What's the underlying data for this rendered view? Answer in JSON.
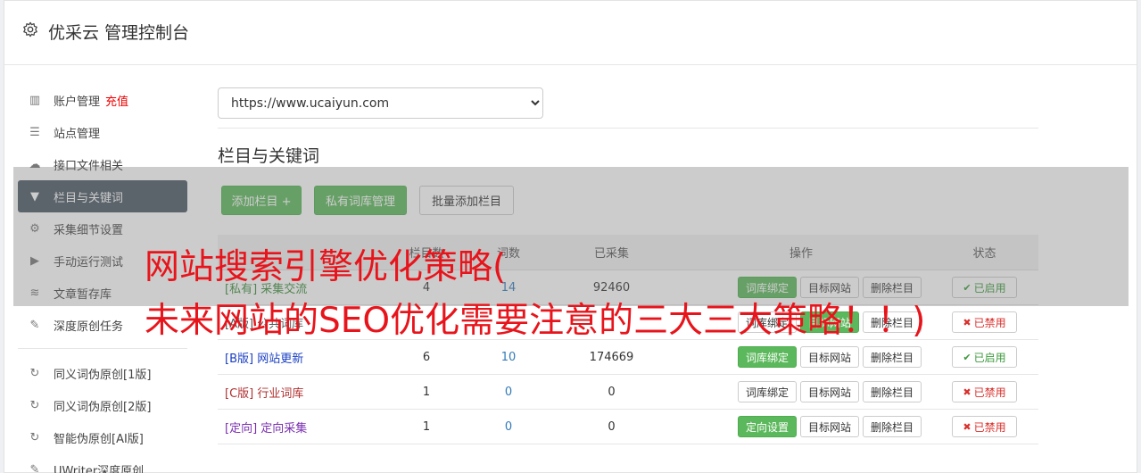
{
  "header": {
    "title": "优采云 管理控制台"
  },
  "sidebar": {
    "items": [
      {
        "label": "账户管理",
        "badge": "充值",
        "icon": "bar-chart-icon",
        "glyph": "▥"
      },
      {
        "label": "站点管理",
        "icon": "server-icon",
        "glyph": "☰"
      },
      {
        "label": "接口文件相关",
        "icon": "cloud-upload-icon",
        "glyph": "☁"
      },
      {
        "label": "栏目与关键词",
        "icon": "filter-icon",
        "glyph": "▼",
        "active": true
      },
      {
        "label": "采集细节设置",
        "icon": "gears-icon",
        "glyph": "⚙"
      },
      {
        "label": "手动运行测试",
        "icon": "play-icon",
        "glyph": "▶"
      },
      {
        "label": "文章暂存库",
        "icon": "database-icon",
        "glyph": "≋"
      },
      {
        "label": "深度原创任务",
        "icon": "edit-icon",
        "glyph": "✎"
      }
    ],
    "items2": [
      {
        "label": "同义词伪原创[1版]",
        "icon": "refresh-icon",
        "glyph": "↻"
      },
      {
        "label": "同义词伪原创[2版]",
        "icon": "refresh-icon",
        "glyph": "↻"
      },
      {
        "label": "智能伪原创[AI版]",
        "icon": "refresh-icon",
        "glyph": "↻"
      },
      {
        "label": "UWriter深度原创",
        "icon": "edit-icon",
        "glyph": "✎"
      }
    ]
  },
  "main": {
    "site_select": "https://www.ucaiyun.com",
    "section_title": "栏目与关键词",
    "buttons": {
      "add": "添加栏目 +",
      "private": "私有词库管理",
      "batch": "批量添加栏目"
    }
  },
  "table": {
    "headers": [
      "",
      "栏目数",
      "词数",
      "已采集",
      "操作",
      "状态"
    ],
    "rows": [
      {
        "name": "[私有] 采集交流",
        "n1": "4",
        "n2": "14",
        "n3": "92460",
        "op1": "词库绑定",
        "op2": "目标网站",
        "op3": "删除栏目",
        "status": "已启用"
      },
      {
        "name": "[A版] 公共词库",
        "n1": "",
        "n2": "",
        "n3": "",
        "op1": "词库绑定",
        "op2": "目标网站",
        "op3": "删除栏目",
        "status": "已禁用"
      },
      {
        "name": "[B版] 网站更新",
        "n1": "6",
        "n2": "10",
        "n3": "174669",
        "op1": "词库绑定",
        "op2": "目标网站",
        "op3": "删除栏目",
        "status": "已启用"
      },
      {
        "name": "[C版] 行业词库",
        "n1": "1",
        "n2": "0",
        "n3": "0",
        "op1": "词库绑定",
        "op2": "目标网站",
        "op3": "删除栏目",
        "status": "已禁用"
      },
      {
        "name": "[定向] 定向采集",
        "n1": "1",
        "n2": "0",
        "n3": "0",
        "op1": "定向设置",
        "op2": "目标网站",
        "op3": "删除栏目",
        "status": "已禁用"
      }
    ]
  },
  "overlay": {
    "line1": "网站搜索引擎优化策略(",
    "line2": "未来网站的SEO优化需要注意的三大三大策略！！)"
  }
}
